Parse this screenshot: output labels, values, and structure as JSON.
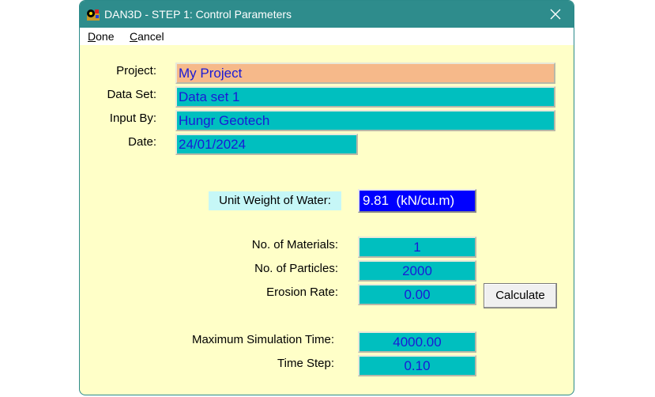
{
  "window": {
    "title": "DAN3D - STEP 1: Control Parameters",
    "app_icon": "dan3d-app-icon",
    "close_icon": "close-icon"
  },
  "menu": {
    "done": {
      "accel": "D",
      "rest": "one"
    },
    "cancel": {
      "accel": "C",
      "rest": "ancel"
    }
  },
  "project": {
    "project_label": "Project:",
    "project_value": "My Project",
    "dataset_label": "Data Set:",
    "dataset_value": "Data set 1",
    "inputby_label": "Input By:",
    "inputby_value": "Hungr Geotech",
    "date_label": "Date:",
    "date_value": "24/01/2024"
  },
  "water": {
    "label": "Unit Weight of Water:",
    "value": "9.81  (kN/cu.m)"
  },
  "params": {
    "materials_label": "No. of Materials:",
    "materials_value": "1",
    "particles_label": "No. of Particles:",
    "particles_value": "2000",
    "erosion_label": "Erosion Rate:",
    "erosion_value": "0.00",
    "calculate_label": "Calculate"
  },
  "simulation": {
    "max_time_label": "Maximum Simulation Time:",
    "max_time_value": "4000.00",
    "time_step_label": "Time Step:",
    "time_step_value": "0.10"
  },
  "colors": {
    "titlebar": "#2e8c8c",
    "form_bg": "#ffffc8",
    "field_teal": "#00bfbf",
    "field_orange": "#f6b98a",
    "field_text": "#1a1ad6",
    "water_bg": "#0000ff"
  }
}
